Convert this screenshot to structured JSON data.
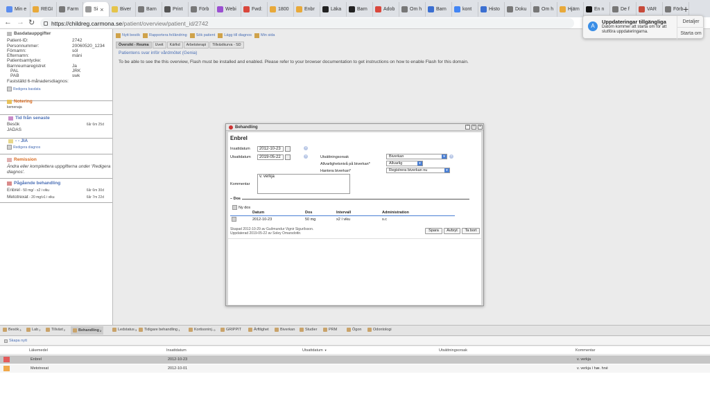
{
  "browser": {
    "tabs": [
      {
        "label": "Min e",
        "color": "#5b8def"
      },
      {
        "label": "REGI",
        "color": "#e8a93a"
      },
      {
        "label": "Farm",
        "color": "#777777"
      },
      {
        "label": "Si",
        "color": "#999999",
        "active": true
      },
      {
        "label": "Biver",
        "color": "#e5c44a"
      },
      {
        "label": "Barn",
        "color": "#777777"
      },
      {
        "label": "Print",
        "color": "#555555"
      },
      {
        "label": "Förb",
        "color": "#777777"
      },
      {
        "label": "Webi",
        "color": "#9b4fd1"
      },
      {
        "label": "Fwd:",
        "color": "#d9473c"
      },
      {
        "label": "1800",
        "color": "#e8a93a"
      },
      {
        "label": "Enbr",
        "color": "#e8a93a"
      },
      {
        "label": "Läka",
        "color": "#222222"
      },
      {
        "label": "Barn",
        "color": "#222222"
      },
      {
        "label": "Adob",
        "color": "#d9473c"
      },
      {
        "label": "Om h",
        "color": "#777777"
      },
      {
        "label": "Barn",
        "color": "#3b6fd1"
      },
      {
        "label": "kont",
        "color": "#4285f4"
      },
      {
        "label": "Histo",
        "color": "#3b6fd1"
      },
      {
        "label": "Doku",
        "color": "#777777"
      },
      {
        "label": "Om h",
        "color": "#777777"
      },
      {
        "label": "Hjärn",
        "color": "#e8a93a"
      },
      {
        "label": "En n",
        "color": "#111111"
      },
      {
        "label": "De f",
        "color": "#777777"
      },
      {
        "label": "VAR",
        "color": "#c74a3a"
      },
      {
        "label": "Förb",
        "color": "#777777"
      }
    ],
    "new_tab": "+",
    "url_host": "https://childreg.carmona.se",
    "url_path": "/patient/overview/patient_id/2742"
  },
  "notification": {
    "title": "Uppdateringar tillgängliga",
    "message": "Datorn kommer att starta om för att slutföra uppdateringarna.",
    "action1": "Detaljer",
    "action2": "Starta om",
    "edge_text": "ide"
  },
  "sidebar": {
    "basdata_title": "Basdatauppgifter",
    "fields": [
      {
        "label": "Patient-ID:",
        "value": "2742"
      },
      {
        "label": "Personnummer:",
        "value": "20060520_1234"
      },
      {
        "label": "Förnamn:",
        "value": "sól"
      },
      {
        "label": "Efternamn:",
        "value": "máni"
      },
      {
        "label": "Patientsamtycke:",
        "value": ""
      },
      {
        "label": "Barnreumaregistret",
        "value": "Ja"
      },
      {
        "label": "PAL",
        "value": "JRK"
      },
      {
        "label": "PAB",
        "value": "swk"
      },
      {
        "label": "Fastställd 6-månadersdiagnos:",
        "value": ""
      }
    ],
    "edit_basdata": "Redigera basdata",
    "notering_title": "Notering",
    "notering_text": "kemenaja",
    "tid_title": "Tid från senaste",
    "tid_besok": "Besök",
    "tid_besok_value": "6år 6m 25d",
    "tid_jadas": "JADAS",
    "jia_title": "- - JIA",
    "edit_diagnos": "Redigera diagnos",
    "remission_title": "Remission",
    "remission_text": "Ändra eller komplettera uppgifterna under 'Redigera diagnos'.",
    "pagaende_title": "Pågående behandling",
    "treatments": [
      {
        "name": "Enbrel",
        "detail": " - 50 mg/ - x2 i viku",
        "time": "6år 6m 30d"
      },
      {
        "name": "Metotrexat",
        "detail": " - 20 mg/v1 i viku",
        "time": "6år 7m 22d"
      }
    ]
  },
  "actionbar": {
    "items": [
      "Nytt besök",
      "Rapportera fel/ändring",
      "Sök patient",
      "Lägg till diagnos",
      "Min sida"
    ]
  },
  "subtabs": [
    "Översikt - Reuma",
    "Uveit",
    "Kärlkd",
    "Arbetsterapi",
    "Tillväxtkurva - SD"
  ],
  "main": {
    "subtitle": "Patientens svar inför vårdmötet (Genia)",
    "flash_message": "To be able to see the this overview, Flash must be installed and enabled. Please refer to your browser documentation to get instructions on how to enable Flash for this domain."
  },
  "dialog": {
    "title": "Behandling",
    "heading": "Enbrel",
    "insatt_label": "Insattdatum",
    "insatt_value": "2012-10-23",
    "utsatt_label": "Utsattdatum",
    "utsatt_value": "2019-05-22",
    "orsak_label": "Utsättningsorsak",
    "orsak_value": "Biverkan",
    "allvar_label": "Allvarlighetsnivå på biverkan*",
    "allvar_value": "Allvarlig",
    "hantera_label": "Hantera biverkan*",
    "hantera_value": "Registrera biverkan nu",
    "kommentar_label": "Kommentar",
    "kommentar_value": "v. verkja",
    "dos_title": "Dos",
    "ny_dos": "Ny dos",
    "dos_headers": [
      "Datum",
      "Dos",
      "Intervall",
      "Administration"
    ],
    "dos_rows": [
      [
        "2012-10-23",
        "50 mg",
        "x2 í viku",
        "s.c"
      ]
    ],
    "skapad": "Skapad 2012-10-29 av Guðmundur Vignir Sigurðsson.",
    "uppdaterad": "Uppdaterad 2019-05-22 av Soley Omarsdottir.",
    "save": "Spara",
    "cancel": "Avbryt",
    "delete": "Ta bort",
    "help": "?"
  },
  "bottom_tabs": [
    {
      "label": "Besök",
      "count": "3"
    },
    {
      "label": "Lab",
      "count": "2"
    },
    {
      "label": "Tillväxt",
      "count": "2"
    },
    {
      "label": "Behandling",
      "count": "2",
      "active": true
    },
    {
      "label": "Ledstatus",
      "count": "3"
    },
    {
      "label": "Tidigare behandling",
      "count": "1"
    },
    {
      "label": "Kortisoninj.",
      "count": "0"
    },
    {
      "label": "GRIPPIT",
      "count": ""
    },
    {
      "label": "Ärftlighet",
      "count": ""
    },
    {
      "label": "Biverkan",
      "count": ""
    },
    {
      "label": "Studier",
      "count": ""
    },
    {
      "label": "PRM",
      "count": ""
    },
    {
      "label": "Ögon",
      "count": ""
    },
    {
      "label": "Odontologi",
      "count": ""
    }
  ],
  "grid": {
    "create_new": "Skapa nytt",
    "headers": [
      "Läkemedel",
      "Insattdatum",
      "Utsattdatum",
      "Utsättningsorsak",
      "Kommentar"
    ],
    "sort_indicator": "▼",
    "rows": [
      {
        "color": "#e35b5b",
        "drug": "Enbrel",
        "insatt": "2012-10-23",
        "utsatt": "",
        "orsak": "",
        "kommentar": "v. verkja"
      },
      {
        "color": "#f0a84a",
        "drug": "Metotrexat",
        "insatt": "2012-10-01",
        "utsatt": "",
        "orsak": "",
        "kommentar": "v. verkja í hæ. hné"
      }
    ]
  }
}
